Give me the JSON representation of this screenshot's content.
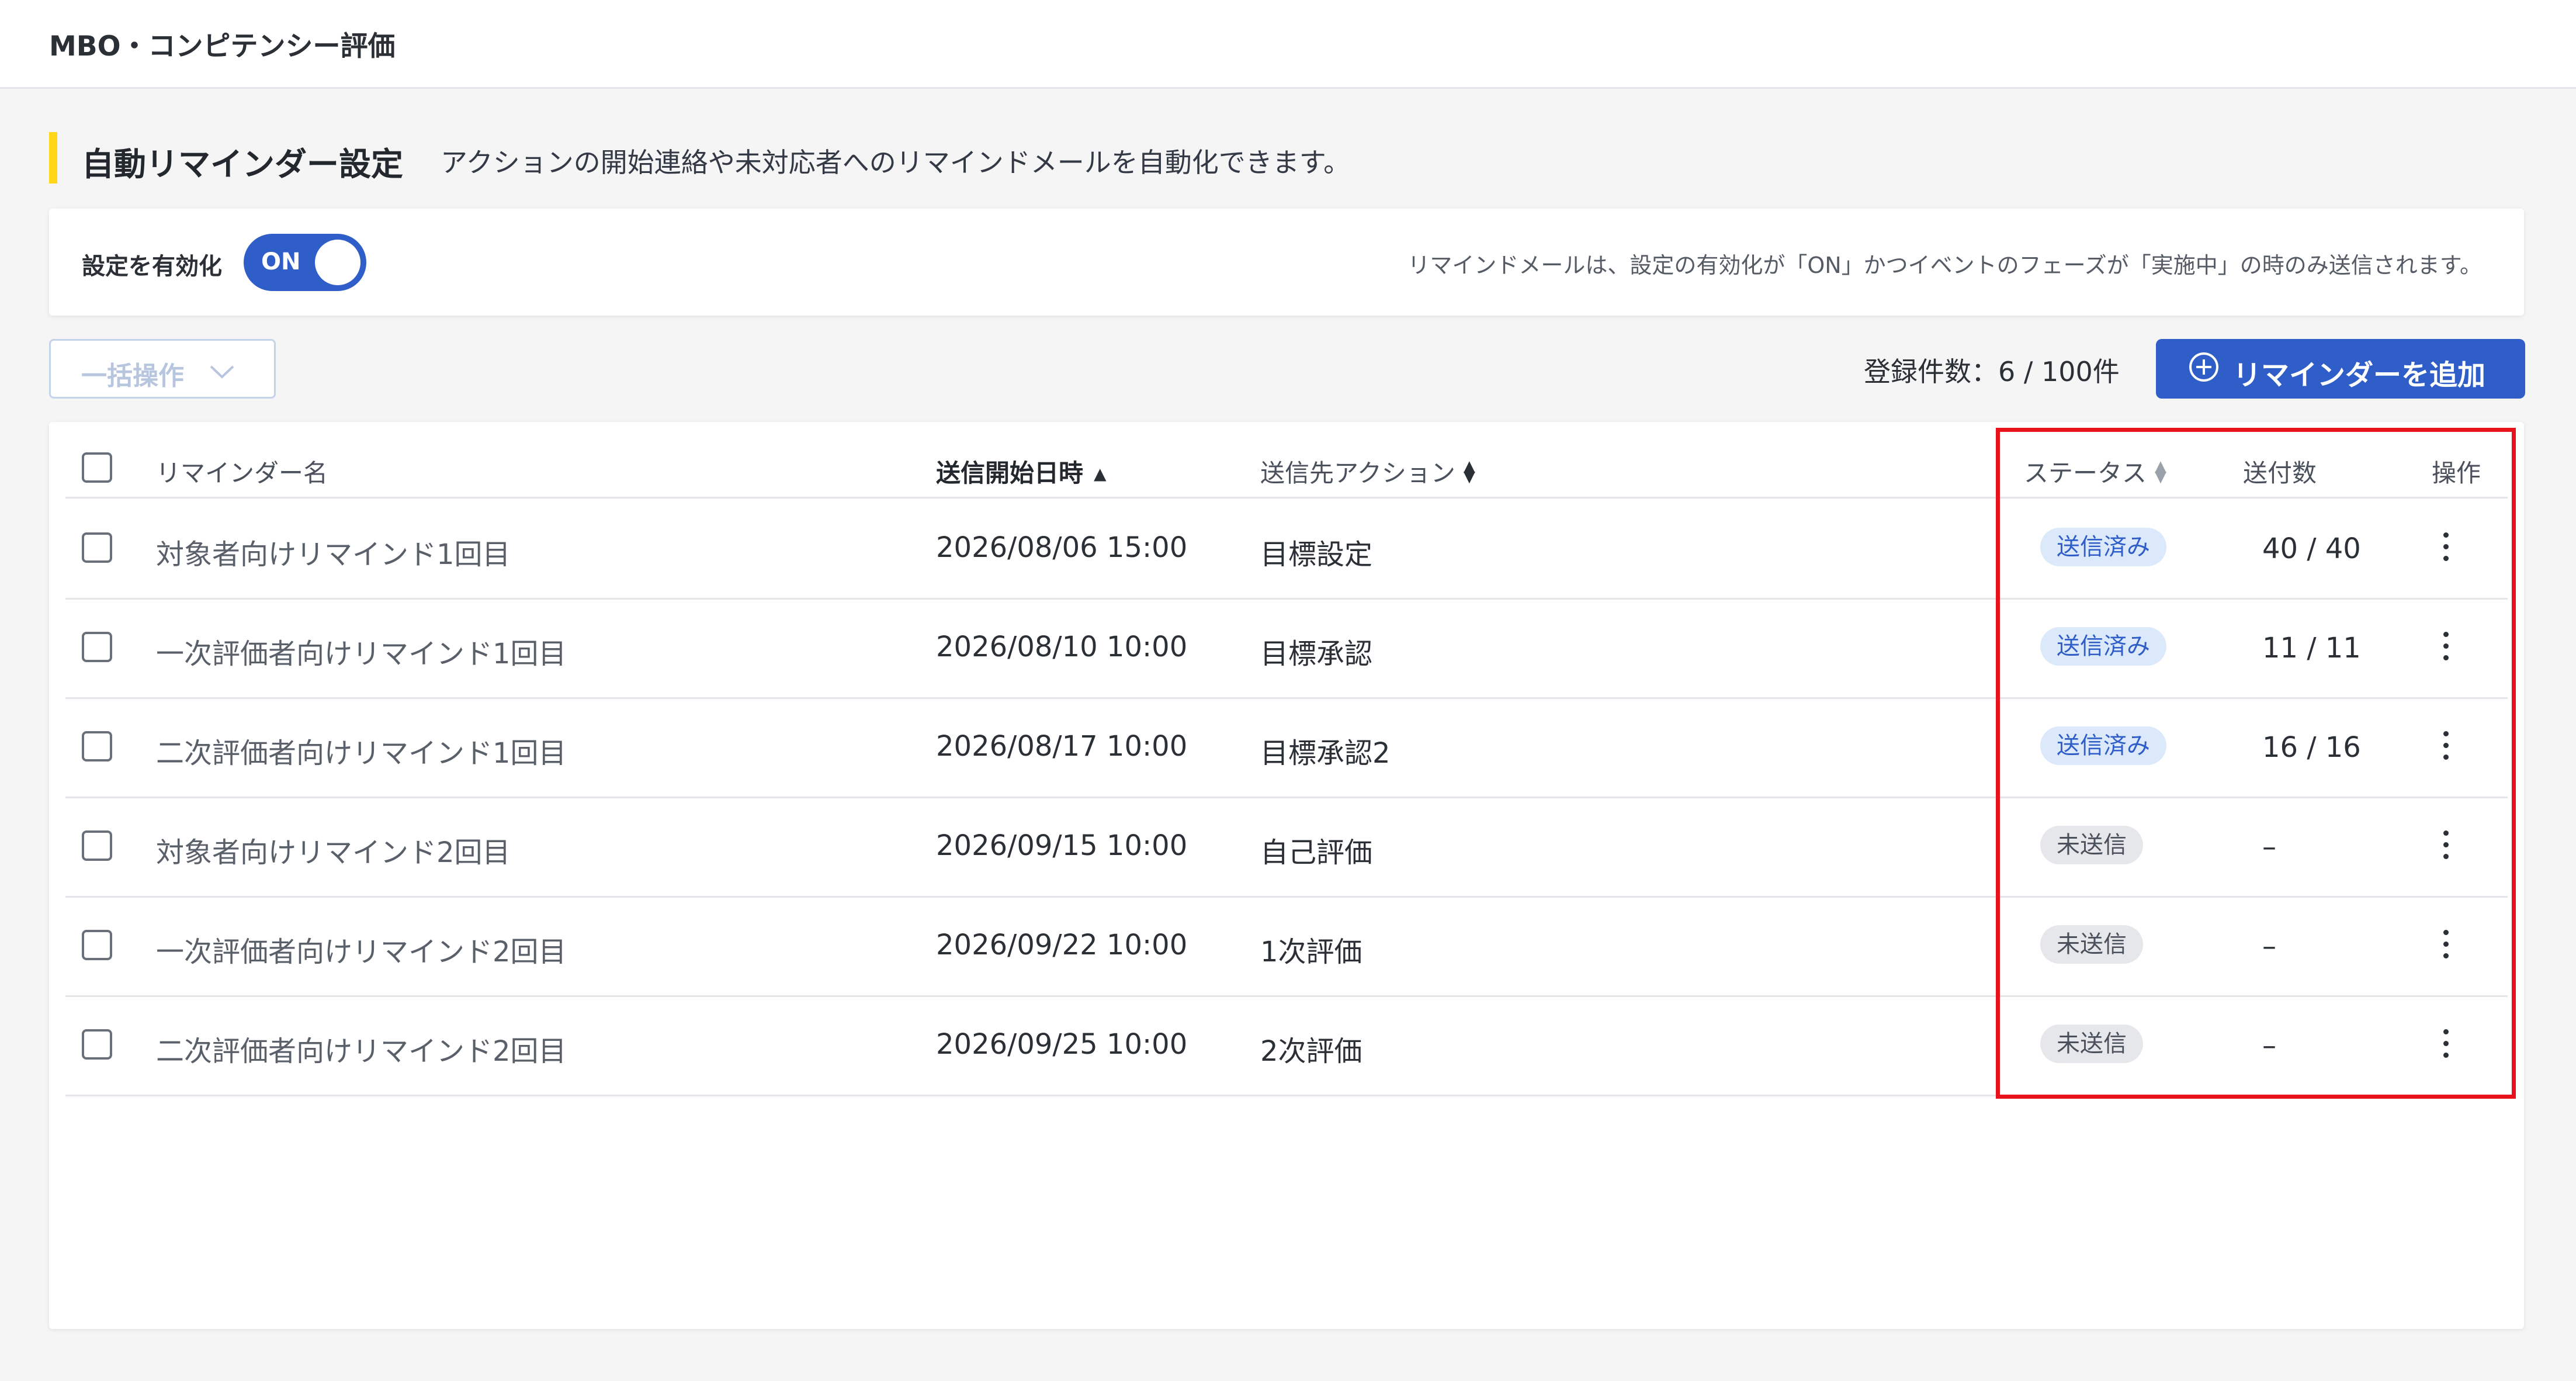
{
  "app": {
    "title": "MBO・コンピテンシー評価"
  },
  "section": {
    "title": "自動リマインダー設定",
    "description": "アクションの開始連絡や未対応者へのリマインドメールを自動化できます。"
  },
  "settings": {
    "enable_label": "設定を有効化",
    "toggle_state": "ON",
    "note": "リマインドメールは、設定の有効化が「ON」かつイベントのフェーズが「実施中」の時のみ送信されます。"
  },
  "toolbar": {
    "bulk_label": "一括操作",
    "count_text": "登録件数：6 / 100件",
    "add_label": "リマインダーを追加"
  },
  "table": {
    "headers": {
      "name": "リマインダー名",
      "date": "送信開始日時",
      "action": "送信先アクション",
      "status": "ステータス",
      "count": "送付数",
      "ops": "操作"
    },
    "rows": [
      {
        "name": "対象者向けリマインド1回目",
        "date": "2026/08/06 15:00",
        "action": "目標設定",
        "status": "送信済み",
        "count": "40 / 40"
      },
      {
        "name": "一次評価者向けリマインド1回目",
        "date": "2026/08/10 10:00",
        "action": "目標承認",
        "status": "送信済み",
        "count": "11 / 11"
      },
      {
        "name": "二次評価者向けリマインド1回目",
        "date": "2026/08/17 10:00",
        "action": "目標承認2",
        "status": "送信済み",
        "count": "16 / 16"
      },
      {
        "name": "対象者向けリマインド2回目",
        "date": "2026/09/15 10:00",
        "action": "自己評価",
        "status": "未送信",
        "count": "–"
      },
      {
        "name": "一次評価者向けリマインド2回目",
        "date": "2026/09/22 10:00",
        "action": "1次評価",
        "status": "未送信",
        "count": "–"
      },
      {
        "name": "二次評価者向けリマインド2回目",
        "date": "2026/09/25 10:00",
        "action": "2次評価",
        "status": "未送信",
        "count": "–"
      }
    ]
  },
  "colors": {
    "primary": "#2f5ec8",
    "accent": "#ffd618",
    "highlight": "#e8121b",
    "badge_sent_bg": "#dbe9fb",
    "badge_unsent_bg": "#e6e7ea"
  }
}
